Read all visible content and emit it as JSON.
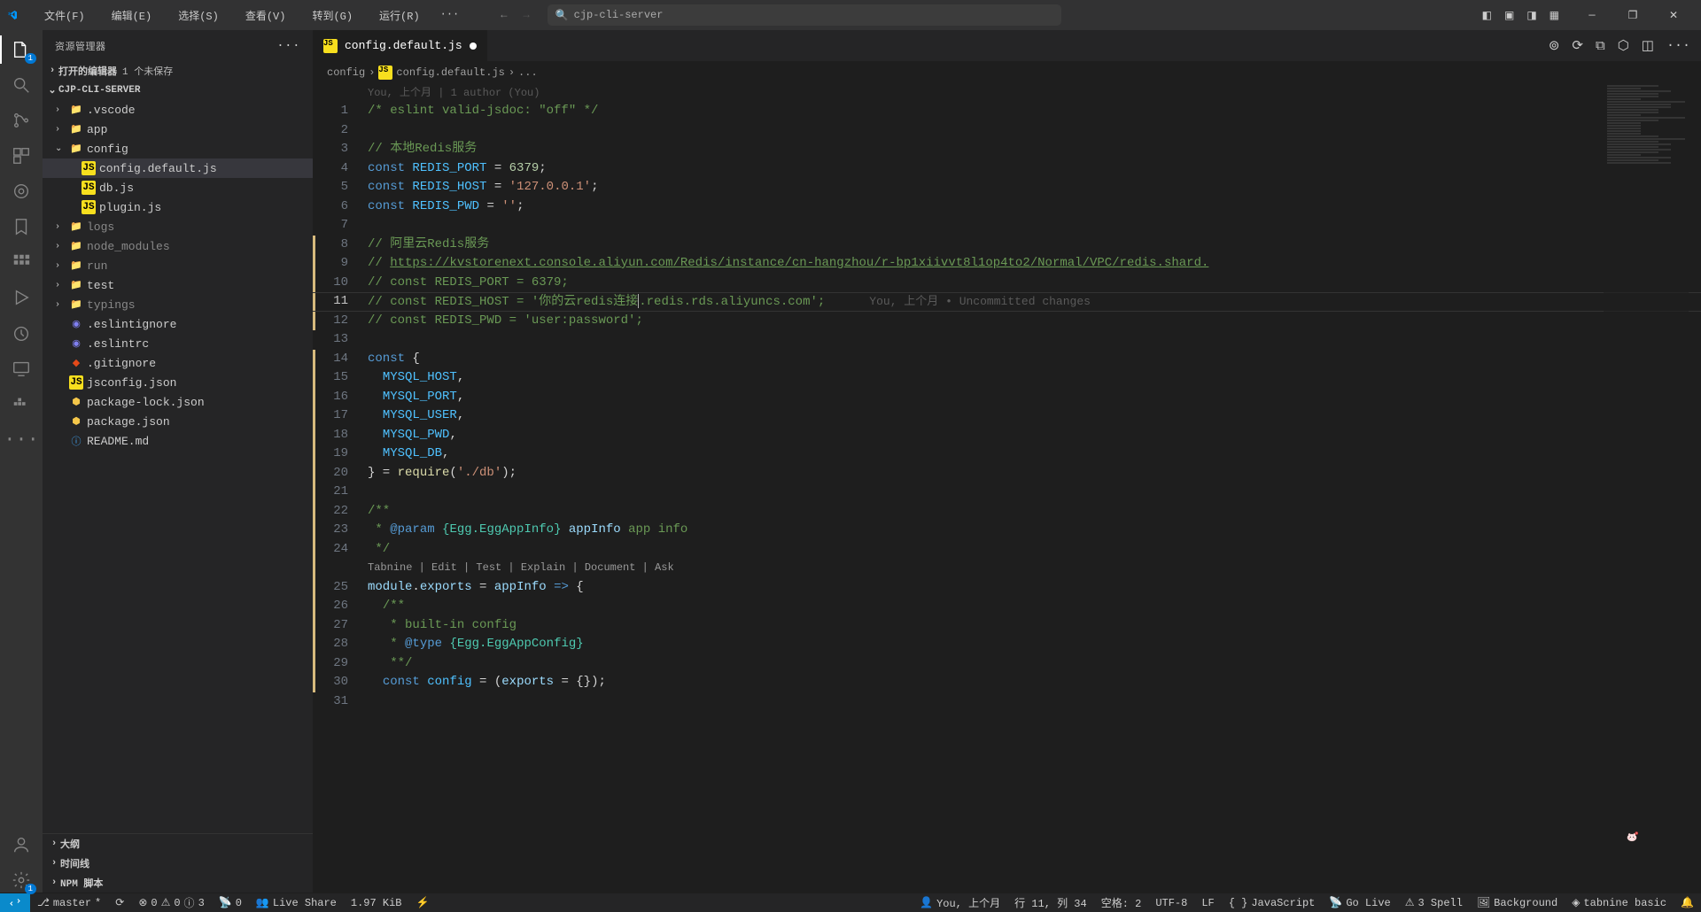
{
  "title": {
    "search": "cjp-cli-server"
  },
  "menus": [
    "文件(F)",
    "编辑(E)",
    "选择(S)",
    "查看(V)",
    "转到(G)",
    "运行(R)"
  ],
  "sidebar": {
    "title": "资源管理器",
    "open_editors": {
      "label": "打开的编辑器",
      "badge": "1 个未保存"
    },
    "project": "CJP-CLI-SERVER",
    "tree": [
      {
        "k": "folder",
        "name": ".vscode",
        "depth": 1,
        "exp": false
      },
      {
        "k": "folder",
        "name": "app",
        "depth": 1,
        "exp": false
      },
      {
        "k": "folder",
        "name": "config",
        "depth": 1,
        "exp": true
      },
      {
        "k": "js",
        "name": "config.default.js",
        "depth": 2,
        "sel": true
      },
      {
        "k": "js",
        "name": "db.js",
        "depth": 2
      },
      {
        "k": "js",
        "name": "plugin.js",
        "depth": 2
      },
      {
        "k": "folder",
        "name": "logs",
        "depth": 1,
        "exp": false,
        "dim": true
      },
      {
        "k": "folder",
        "name": "node_modules",
        "depth": 1,
        "exp": false,
        "dim": true
      },
      {
        "k": "folder",
        "name": "run",
        "depth": 1,
        "exp": false,
        "dim": true
      },
      {
        "k": "folder",
        "name": "test",
        "depth": 1,
        "exp": false
      },
      {
        "k": "folder",
        "name": "typings",
        "depth": 1,
        "exp": false,
        "dim": true
      },
      {
        "k": "eslint",
        "name": ".eslintignore",
        "depth": 1
      },
      {
        "k": "eslint",
        "name": ".eslintrc",
        "depth": 1
      },
      {
        "k": "git",
        "name": ".gitignore",
        "depth": 1
      },
      {
        "k": "js",
        "name": "jsconfig.json",
        "depth": 1
      },
      {
        "k": "json",
        "name": "package-lock.json",
        "depth": 1
      },
      {
        "k": "json",
        "name": "package.json",
        "depth": 1
      },
      {
        "k": "md",
        "name": "README.md",
        "depth": 1
      }
    ],
    "outline": "大纲",
    "timeline": "时间线",
    "npm": "NPM 脚本"
  },
  "tab": {
    "name": "config.default.js"
  },
  "breadcrumb": [
    "config",
    "config.default.js",
    "..."
  ],
  "blame_top": "You, 上个月 | 1 author (You)",
  "git_inline": "You, 上个月 • Uncommitted changes",
  "code_lens": "Tabnine | Edit | Test | Explain | Document | Ask",
  "lines": [
    {
      "n": 1,
      "seg": [
        [
          "cm",
          "/* eslint valid-jsdoc: \"off\" */"
        ]
      ]
    },
    {
      "n": 2,
      "seg": []
    },
    {
      "n": 3,
      "seg": [
        [
          "cm",
          "// 本地Redis服务"
        ]
      ]
    },
    {
      "n": 4,
      "seg": [
        [
          "kw",
          "const "
        ],
        [
          "cn",
          "REDIS_PORT"
        ],
        [
          "pn",
          " = "
        ],
        [
          "nm",
          "6379"
        ],
        [
          "pn",
          ";"
        ]
      ]
    },
    {
      "n": 5,
      "seg": [
        [
          "kw",
          "const "
        ],
        [
          "cn",
          "REDIS_HOST"
        ],
        [
          "pn",
          " = "
        ],
        [
          "st",
          "'127.0.0.1'"
        ],
        [
          "pn",
          ";"
        ]
      ]
    },
    {
      "n": 6,
      "seg": [
        [
          "kw",
          "const "
        ],
        [
          "cn",
          "REDIS_PWD"
        ],
        [
          "pn",
          " = "
        ],
        [
          "st",
          "''"
        ],
        [
          "pn",
          ";"
        ]
      ]
    },
    {
      "n": 7,
      "seg": []
    },
    {
      "n": 8,
      "seg": [
        [
          "cm",
          "// 阿里云Redis服务"
        ]
      ]
    },
    {
      "n": 9,
      "seg": [
        [
          "cm",
          "// "
        ],
        [
          "lnk",
          "https://kvstorenext.console.aliyun.com/Redis/instance/cn-hangzhou/r-bp1xiivvt8l1op4to2/Normal/VPC/redis.shard."
        ]
      ]
    },
    {
      "n": 10,
      "seg": [
        [
          "cm",
          "// const REDIS_PORT = 6379;"
        ]
      ]
    },
    {
      "n": 11,
      "cur": true,
      "seg": [
        [
          "cm",
          "// const REDIS_HOST = '你的云redis连接"
        ],
        [
          "cursor",
          ""
        ],
        [
          "cm",
          ".redis.rds.aliyuncs.com';"
        ]
      ],
      "ann": true
    },
    {
      "n": 12,
      "seg": [
        [
          "cm",
          "// const REDIS_PWD = 'user:password';"
        ]
      ]
    },
    {
      "n": 13,
      "seg": []
    },
    {
      "n": 14,
      "seg": [
        [
          "kw",
          "const"
        ],
        [
          "pn",
          " {"
        ]
      ]
    },
    {
      "n": 15,
      "seg": [
        [
          "pn",
          "  "
        ],
        [
          "cn",
          "MYSQL_HOST"
        ],
        [
          "pn",
          ","
        ]
      ]
    },
    {
      "n": 16,
      "seg": [
        [
          "pn",
          "  "
        ],
        [
          "cn",
          "MYSQL_PORT"
        ],
        [
          "pn",
          ","
        ]
      ]
    },
    {
      "n": 17,
      "seg": [
        [
          "pn",
          "  "
        ],
        [
          "cn",
          "MYSQL_USER"
        ],
        [
          "pn",
          ","
        ]
      ]
    },
    {
      "n": 18,
      "seg": [
        [
          "pn",
          "  "
        ],
        [
          "cn",
          "MYSQL_PWD"
        ],
        [
          "pn",
          ","
        ]
      ]
    },
    {
      "n": 19,
      "seg": [
        [
          "pn",
          "  "
        ],
        [
          "cn",
          "MYSQL_DB"
        ],
        [
          "pn",
          ","
        ]
      ]
    },
    {
      "n": 20,
      "seg": [
        [
          "pn",
          "} = "
        ],
        [
          "fn",
          "require"
        ],
        [
          "pn",
          "("
        ],
        [
          "st",
          "'./db'"
        ],
        [
          "pn",
          ");"
        ]
      ]
    },
    {
      "n": 21,
      "seg": []
    },
    {
      "n": 22,
      "seg": [
        [
          "cm",
          "/**"
        ]
      ]
    },
    {
      "n": 23,
      "seg": [
        [
          "cm",
          " * "
        ],
        [
          "kw",
          "@param"
        ],
        [
          "cm",
          " "
        ],
        [
          "ty",
          "{Egg.EggAppInfo}"
        ],
        [
          "cm",
          " "
        ],
        [
          "vr",
          "appInfo"
        ],
        [
          "cm",
          " app info"
        ]
      ]
    },
    {
      "n": 24,
      "seg": [
        [
          "cm",
          " */"
        ]
      ]
    },
    {
      "n": "lens"
    },
    {
      "n": 25,
      "seg": [
        [
          "vr",
          "module"
        ],
        [
          "pn",
          "."
        ],
        [
          "vr",
          "exports"
        ],
        [
          "pn",
          " = "
        ],
        [
          "vr",
          "appInfo"
        ],
        [
          "pn",
          " "
        ],
        [
          "kw",
          "=>"
        ],
        [
          "pn",
          " {"
        ]
      ]
    },
    {
      "n": 26,
      "seg": [
        [
          "pn",
          "  "
        ],
        [
          "cm",
          "/**"
        ]
      ]
    },
    {
      "n": 27,
      "seg": [
        [
          "pn",
          "  "
        ],
        [
          "cm",
          " * built-in config"
        ]
      ]
    },
    {
      "n": 28,
      "seg": [
        [
          "pn",
          "  "
        ],
        [
          "cm",
          " * "
        ],
        [
          "kw",
          "@type"
        ],
        [
          "cm",
          " "
        ],
        [
          "ty",
          "{Egg.EggAppConfig}"
        ]
      ]
    },
    {
      "n": 29,
      "seg": [
        [
          "pn",
          "  "
        ],
        [
          "cm",
          " **/"
        ]
      ]
    },
    {
      "n": 30,
      "seg": [
        [
          "pn",
          "  "
        ],
        [
          "kw",
          "const"
        ],
        [
          "pn",
          " "
        ],
        [
          "cn",
          "config"
        ],
        [
          "pn",
          " = ("
        ],
        [
          "vr",
          "exports"
        ],
        [
          "pn",
          " = {});"
        ]
      ]
    },
    {
      "n": 31,
      "seg": []
    }
  ],
  "status": {
    "branch": "master",
    "sync": "",
    "err": "0",
    "warn": "0",
    "info": "3",
    "port": "0",
    "liveshare": "Live Share",
    "size": "1.97 KiB",
    "blame": "You, 上个月",
    "pos": "行 11, 列 34",
    "spaces": "空格: 2",
    "enc": "UTF-8",
    "eol": "LF",
    "lang": "JavaScript",
    "golive": "Go Live",
    "spell": "3 Spell",
    "bg": "Background",
    "tabnine": "tabnine basic"
  }
}
